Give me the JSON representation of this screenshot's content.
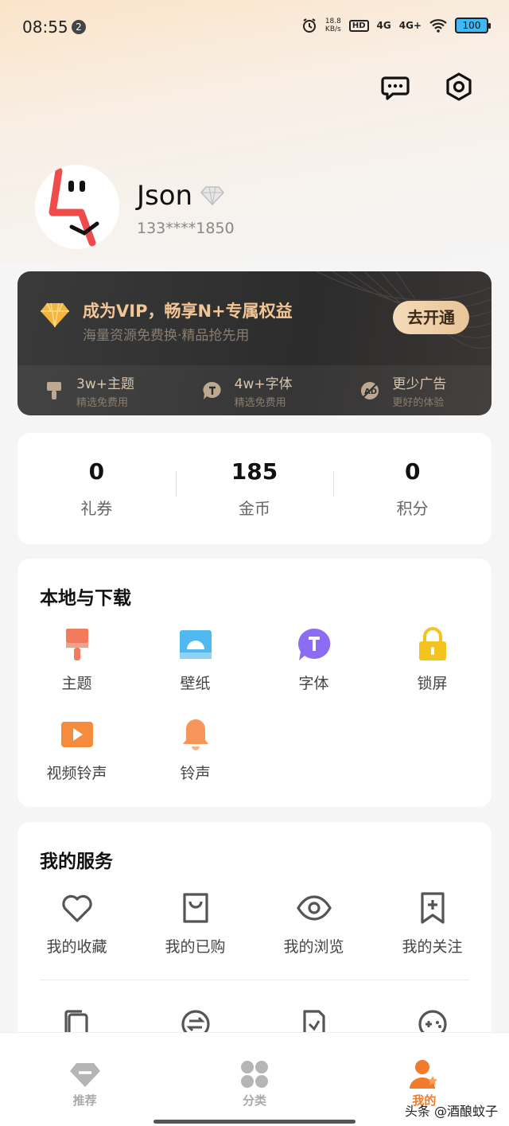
{
  "status_bar": {
    "time": "08:55",
    "notification_count": "2",
    "speed_top": "18.8",
    "speed_unit": "KB/s",
    "hd": "HD",
    "network_1": "4G",
    "network_2": "4G+",
    "battery": "100"
  },
  "profile": {
    "username": "Json",
    "phone": "133****1850"
  },
  "vip": {
    "title": "成为VIP，畅享N+专属权益",
    "subtitle": "海量资源免费换·精品抢先用",
    "button": "去开通",
    "perks": [
      {
        "title": "3w+主题",
        "sub": "精选免费用",
        "icon": "brush-icon"
      },
      {
        "title": "4w+字体",
        "sub": "精选免费用",
        "icon": "font-icon"
      },
      {
        "title": "更少广告",
        "sub": "更好的体验",
        "icon": "no-ad-icon"
      }
    ]
  },
  "stats": [
    {
      "value": "0",
      "label": "礼券"
    },
    {
      "value": "185",
      "label": "金币"
    },
    {
      "value": "0",
      "label": "积分"
    }
  ],
  "local": {
    "title": "本地与下载",
    "items": [
      {
        "label": "主题",
        "icon": "theme-brush-icon",
        "color": "#f47a5c"
      },
      {
        "label": "壁纸",
        "icon": "wallpaper-icon",
        "color": "#4fb8f0"
      },
      {
        "label": "字体",
        "icon": "font-icon",
        "color": "#8c6cf0"
      },
      {
        "label": "锁屏",
        "icon": "lock-icon",
        "color": "#f5c320"
      },
      {
        "label": "视频铃声",
        "icon": "video-ringtone-icon",
        "color": "#f58b3c"
      },
      {
        "label": "铃声",
        "icon": "bell-icon",
        "color": "#f5955a"
      }
    ]
  },
  "services": {
    "title": "我的服务",
    "items": [
      {
        "label": "我的收藏",
        "icon": "heart-icon"
      },
      {
        "label": "我的已购",
        "icon": "shopping-bag-icon"
      },
      {
        "label": "我的浏览",
        "icon": "eye-icon"
      },
      {
        "label": "我的关注",
        "icon": "bookmark-plus-icon"
      }
    ]
  },
  "bottom_nav": [
    {
      "label": "推荐",
      "icon": "diamond-nav-icon"
    },
    {
      "label": "分类",
      "icon": "grid-nav-icon"
    },
    {
      "label": "我的",
      "icon": "user-nav-icon"
    }
  ],
  "watermark": "头条 @酒酿蚊子",
  "colors": {
    "accent": "#f27a2b",
    "vip_gold": "#f2c795",
    "vip_bg": "#2e2e2e"
  }
}
